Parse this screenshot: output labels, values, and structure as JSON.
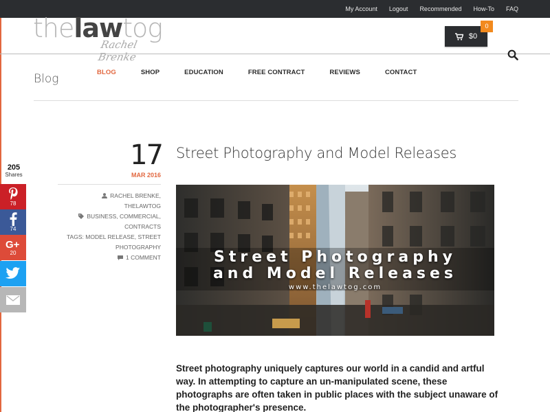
{
  "topbar": {
    "links": [
      "My Account",
      "Logout",
      "Recommended",
      "How-To",
      "FAQ"
    ]
  },
  "logo": {
    "word_light_1": "the",
    "word_bold": "law",
    "word_light_2": "tog",
    "signature": "Rachel Brenke"
  },
  "cart": {
    "amount": "$0",
    "badge": "0"
  },
  "page": {
    "section": "Blog"
  },
  "nav": {
    "items": [
      "BLOG",
      "SHOP",
      "EDUCATION",
      "FREE CONTRACT",
      "REVIEWS",
      "CONTACT"
    ],
    "active": "BLOG"
  },
  "share": {
    "total": "205",
    "total_label": "Shares",
    "pinterest_count": "78",
    "facebook_count": "74",
    "googleplus_count": "20"
  },
  "post": {
    "day": "17",
    "month_year": "MAR 2016",
    "authors": "RACHEL BRENKE, THELAWTOG",
    "categories_1": "BUSINESS, COMMERCIAL,",
    "categories_2": "CONTRACTS",
    "tags_label": "TAGS:",
    "tags_1": "MODEL RELEASE, STREET",
    "tags_2": "PHOTOGRAPHY",
    "comments": "1 COMMENT",
    "title": "Street Photography and Model Releases",
    "hero_line1": "Street Photography",
    "hero_line2": "and Model Releases",
    "hero_url": "www.thelawtog.com",
    "body": "Street photography uniquely captures our world in a candid and artful way. In attempting to capture an un-manipulated scene, these photographs are often taken in public places with the subject unaware of the photographer's presence."
  },
  "colors": {
    "accent": "#e2673f",
    "topbar": "#2b2d30",
    "badge": "#f28a1e"
  }
}
